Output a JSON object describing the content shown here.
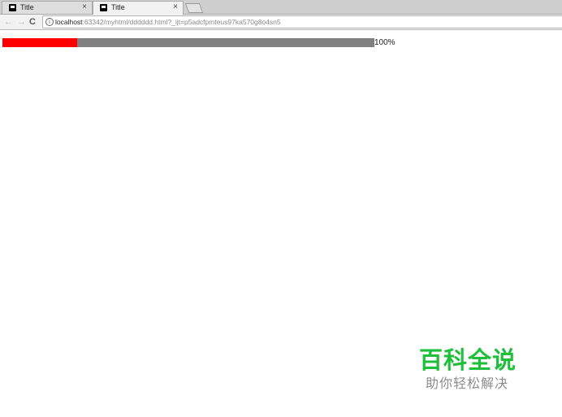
{
  "browser": {
    "tabs": [
      {
        "title": "Title",
        "close": "×"
      },
      {
        "title": "Title",
        "close": "×"
      }
    ],
    "nav": {
      "back": "←",
      "forward": "→",
      "reload": "C"
    },
    "address": {
      "info": "i",
      "host": "localhost",
      "rest": ":63342/myhtml/dddddd.html?_ijt=p5adcfpmteus97ka570g8o4sn5"
    }
  },
  "page": {
    "progress": {
      "fraction": 0.2,
      "label": "100%"
    },
    "colors": {
      "fill": "#ff0000",
      "track": "#808080"
    }
  },
  "watermark": {
    "title": "百科全说",
    "subtitle": "助你轻松解决",
    "color": "#1fbf3c"
  }
}
